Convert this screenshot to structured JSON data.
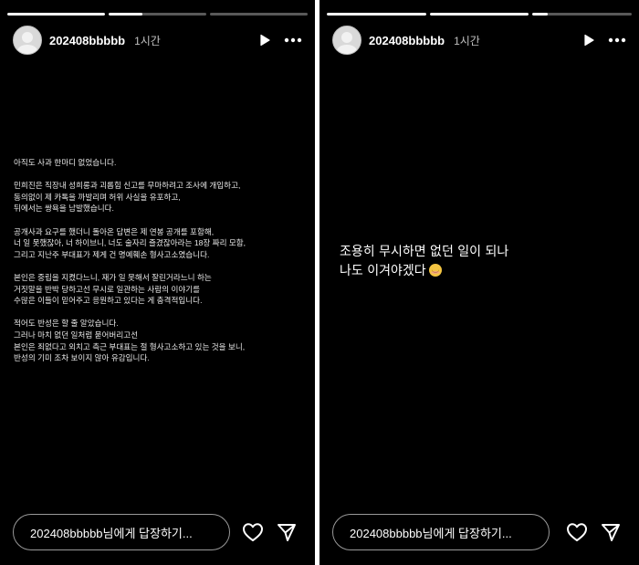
{
  "stories": [
    {
      "username": "202408bbbbb",
      "time": "1시간",
      "progress": [
        1.0,
        0.35,
        0.0
      ],
      "text_lines": [
        "아직도 사과 한마디 없었습니다.",
        "",
        "민희진은 직장내 성희롱과 괴롭힘 신고를 무마하려고 조사에 개입하고,",
        "동의없이 제 카톡을 까발리며 허위 사실을 유포하고,",
        "뒤에서는 쌍욕을 남발했습니다.",
        "",
        "공개사과 요구를 했더니 돌아온 답변은 제 연봉 공개를 포함해,",
        "너 일 못했잖아, 너 하이브니, 너도 술자리 즐겼잖아라는 18장 짜리 모함,",
        "그리고 지난주 부대표가 제게 건 명예훼손 형사고소였습니다.",
        "",
        "본인은 중립을 지켰다느니, 재가 일 못해서 잘린거라느니 하는",
        "거짓말을 반박 당하고선 무시로 일관하는 사람의 이야기를",
        "수많은 이들이 믿어주고 응원하고 있다는 게 충격적입니다.",
        "",
        "적어도 반성은 할 줄 알았습니다.",
        "그러나 마치 없던 일처럼 묻어버리고선",
        "본인은 죄없다고 외치고 측근 부대표는 절 형사고소하고 있는 것을 보니,",
        "반성의 기미 조차 보이지 않아 유감입니다."
      ],
      "reply_placeholder": "202408bbbbb님에게 답장하기..."
    },
    {
      "username": "202408bbbbb",
      "time": "1시간",
      "progress": [
        1.0,
        1.0,
        0.15
      ],
      "text_lines": [
        "조용히 무시하면 없던 일이 되나",
        "나도 이겨야겠다"
      ],
      "reply_placeholder": "202408bbbbb님에게 답장하기..."
    }
  ],
  "icons": {
    "play": "play-icon",
    "more": "more-icon",
    "heart": "heart-icon",
    "send": "send-icon",
    "emoji": "relieved-face-emoji"
  }
}
